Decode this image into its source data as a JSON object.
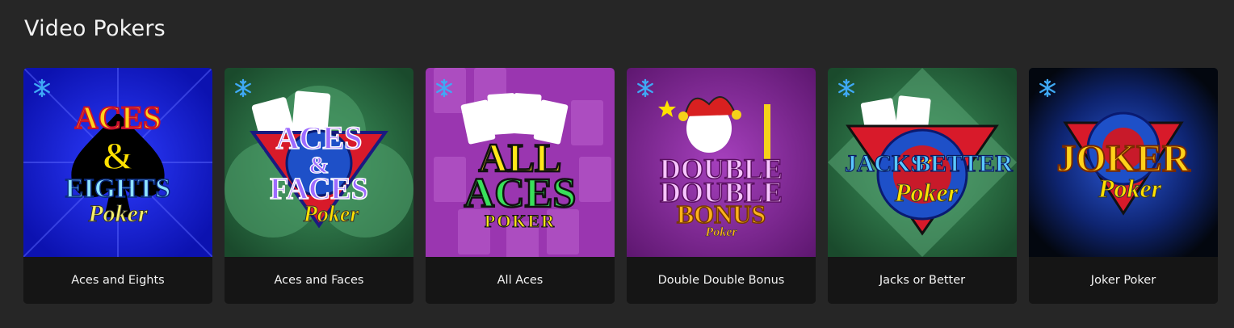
{
  "section": {
    "title": "Video Pokers"
  },
  "games": [
    {
      "label": "Aces and Eights",
      "logo_lines": [
        "ACES",
        "&",
        "EIGHTS",
        "Poker"
      ],
      "colors": {
        "bg": "#1a2ae8",
        "bg_dark": "#0a0fa0"
      }
    },
    {
      "label": "Aces and Faces",
      "logo_lines": [
        "ACES",
        "&",
        "FACES",
        "Poker"
      ],
      "colors": {
        "bg": "#2e7a4a",
        "bg_dark": "#1c4f30"
      }
    },
    {
      "label": "All Aces",
      "logo_lines": [
        "ALL",
        "ACES",
        "POKER"
      ],
      "colors": {
        "bg": "#a63cb8",
        "bg_dark": "#6d1f7c"
      }
    },
    {
      "label": "Double Double Bonus",
      "logo_lines": [
        "DOUBLE",
        "DOUBLE",
        "BONUS",
        "Poker"
      ],
      "colors": {
        "bg": "#8e2fa0",
        "bg_dark": "#5a1566"
      }
    },
    {
      "label": "Jacks or Better",
      "logo_lines": [
        "JACKS",
        "or",
        "BETTER",
        "Poker"
      ],
      "colors": {
        "bg": "#2f7b4c",
        "bg_dark": "#1c4f30"
      }
    },
    {
      "label": "Joker Poker",
      "logo_lines": [
        "JOKER",
        "Poker"
      ],
      "colors": {
        "bg": "#1d3f9a",
        "bg_dark": "#050b1f"
      }
    }
  ],
  "icons": {
    "favorite_marker": "snowflake-icon"
  },
  "accent": "#3fa9f5"
}
